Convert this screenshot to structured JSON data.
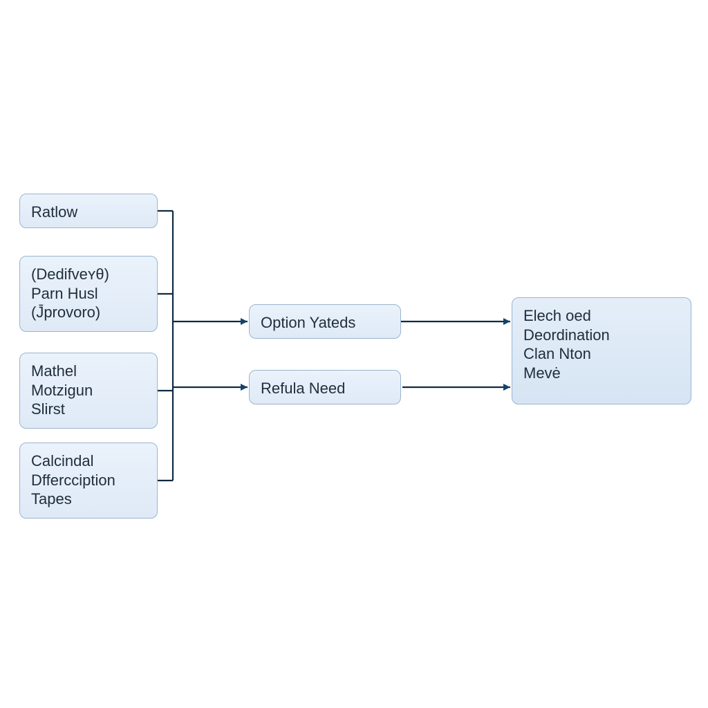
{
  "diagram": {
    "left_nodes": [
      {
        "id": "ratlow",
        "label": "Ratlow"
      },
      {
        "id": "dedifve",
        "label": "(Dedifveʏθ)\nParn Husl\n(J̄provoro)"
      },
      {
        "id": "mathel",
        "label": "Mathel\nMotzigun\nSlirst"
      },
      {
        "id": "calcindal",
        "label": "Calcindal\nDffercciption\nTapes"
      }
    ],
    "middle_nodes": [
      {
        "id": "option",
        "label": "Option Yateds"
      },
      {
        "id": "refula",
        "label": "Refula Need"
      }
    ],
    "right_nodes": [
      {
        "id": "elech",
        "label": "Elech oed\nDeordination\nClan Nton\nMevė"
      }
    ]
  },
  "colors": {
    "node_fill": "#e4eef9",
    "node_border": "#9ab4ce",
    "arrow": "#16426b"
  }
}
